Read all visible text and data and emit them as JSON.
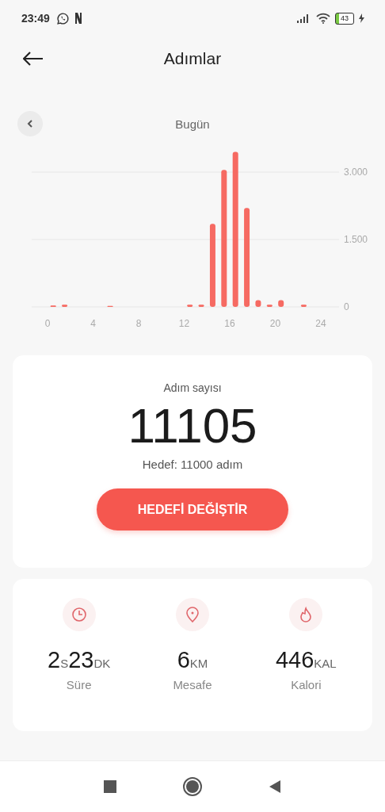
{
  "status_bar": {
    "time": "23:49",
    "battery": "43"
  },
  "header": {
    "title": "Adımlar"
  },
  "day_nav": {
    "label": "Bugün"
  },
  "chart": {
    "chart_data": {
      "type": "bar",
      "x": [
        0.5,
        1.5,
        2.5,
        3.5,
        4.5,
        5.5,
        6.5,
        7.5,
        8.5,
        9.5,
        10.5,
        11.5,
        12.5,
        13.5,
        14.5,
        15.5,
        16.5,
        17.5,
        18.5,
        19.5,
        20.5,
        21.5,
        22.5,
        23.5
      ],
      "series": [
        {
          "color": "#f66a62",
          "values": [
            30,
            50,
            0,
            0,
            0,
            20,
            0,
            0,
            0,
            0,
            0,
            0,
            50,
            50,
            1850,
            3050,
            3450,
            2200,
            150,
            50,
            150,
            0,
            50,
            0
          ]
        }
      ],
      "xlim": [
        -1.4,
        25.6
      ],
      "ylim": [
        0,
        3450
      ],
      "xticks": [
        0,
        4,
        8,
        12,
        16,
        20,
        24
      ],
      "yticks": [
        {
          "value": 0,
          "label": "0"
        },
        {
          "value": 1500,
          "label": "1.500"
        },
        {
          "value": 3000,
          "label": "3.000"
        }
      ]
    }
  },
  "steps_card": {
    "label": "Adım sayısı",
    "value": "11105",
    "goal": "Hedef: 11000 adım",
    "button": "HEDEFİ DEĞİŞTİR"
  },
  "stats": [
    {
      "kind": "clock",
      "parts": [
        {
          "kind": "num",
          "text": "2"
        },
        {
          "kind": "unit",
          "text": "S"
        },
        {
          "kind": "num",
          "text": "23"
        },
        {
          "kind": "unit",
          "text": "DK"
        }
      ],
      "label": "Süre"
    },
    {
      "kind": "pin",
      "parts": [
        {
          "kind": "num",
          "text": "6"
        },
        {
          "kind": "unit",
          "text": "KM"
        }
      ],
      "label": "Mesafe"
    },
    {
      "kind": "flame",
      "parts": [
        {
          "kind": "num",
          "text": "446"
        },
        {
          "kind": "unit",
          "text": "KAL"
        }
      ],
      "label": "Kalori"
    }
  ]
}
